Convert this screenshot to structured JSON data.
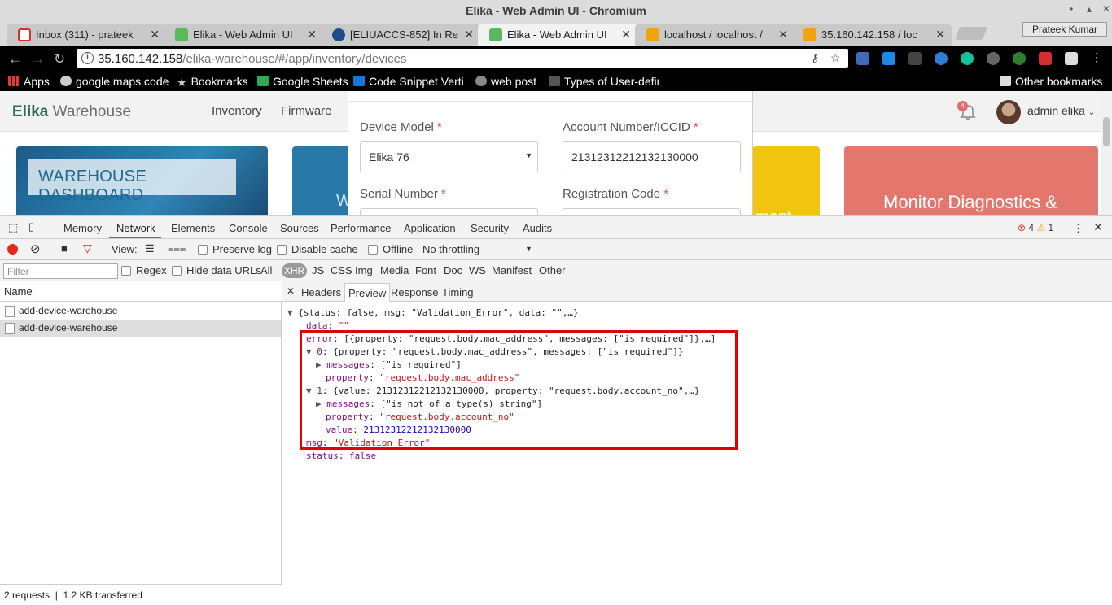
{
  "window": {
    "title": "Elika - Web Admin UI - Chromium",
    "profile": "Prateek Kumar"
  },
  "tabs": [
    {
      "label": "Inbox (311) - prateek"
    },
    {
      "label": "Elika - Web Admin UI"
    },
    {
      "label": "[ELIUACCS-852] In Re"
    },
    {
      "label": "Elika - Web Admin UI"
    },
    {
      "label": "localhost / localhost /"
    },
    {
      "label": "35.160.142.158 / loc"
    }
  ],
  "address": {
    "host": "35.160.142.158",
    "path": "/elika-warehouse/#/app/inventory/devices"
  },
  "bookmarks": {
    "items": [
      "Apps",
      "google maps code",
      "Bookmarks",
      "Google Sheets",
      "Code Snippet Verti",
      "web post",
      "Types of User-define"
    ],
    "other": "Other bookmarks"
  },
  "app": {
    "brand_strong": "Elika",
    "brand_rest": " Warehouse",
    "nav": [
      "Inventory",
      "Firmware"
    ],
    "notifications": "4",
    "user": "admin elika",
    "cards": {
      "dashboard": "WAREHOUSE DASHBOARD",
      "card2": "W",
      "card3": "ment",
      "card4": "Monitor Diagnostics &"
    }
  },
  "form": {
    "device_model_label": "Device Model",
    "device_model_value": "Elika 76",
    "account_label": "Account Number/ICCID",
    "account_value": "21312312212132130000",
    "serial_label": "Serial Number",
    "registration_label": "Registration Code",
    "required": "*"
  },
  "devtools": {
    "tabs": [
      "Memory",
      "Network",
      "Elements",
      "Console",
      "Sources",
      "Performance",
      "Application",
      "Security",
      "Audits"
    ],
    "errors": "4",
    "warnings": "1",
    "toolbar": {
      "view": "View:",
      "preserve_log": "Preserve log",
      "disable_cache": "Disable cache",
      "offline": "Offline",
      "throttling": "No throttling"
    },
    "filter": {
      "placeholder": "Filter",
      "regex": "Regex",
      "hide_data": "Hide data URLs",
      "types": [
        "All",
        "XHR",
        "JS",
        "CSS",
        "Img",
        "Media",
        "Font",
        "Doc",
        "WS",
        "Manifest",
        "Other"
      ]
    },
    "requests": {
      "header": "Name",
      "rows": [
        "add-device-warehouse",
        "add-device-warehouse"
      ],
      "status": "2 requests",
      "transferred": "1.2 KB transferred"
    },
    "detail_tabs": [
      "Headers",
      "Preview",
      "Response",
      "Timing"
    ],
    "preview": {
      "line1": "{status: false, msg: \"Validation_Error\", data: \"\",…}",
      "data_key": "data",
      "data_val": "\"\"",
      "error_key": "error",
      "error_summary": "[{property: \"request.body.mac_address\", messages: [\"is required\"]},…]",
      "e0_key": "0",
      "e0_summary": "{property: \"request.body.mac_address\", messages: [\"is required\"]}",
      "e0_messages": "[\"is required\"]",
      "e0_property": "\"request.body.mac_address\"",
      "e1_key": "1",
      "e1_summary": "{value: 21312312212132130000, property: \"request.body.account_no\",…}",
      "e1_messages": "[\"is not of a type(s) string\"]",
      "e1_property": "\"request.body.account_no\"",
      "e1_value": "21312312212132130000",
      "msg_key": "msg",
      "msg_val": "\"Validation_Error\"",
      "status_key": "status",
      "status_val": "false",
      "messages_key": "messages",
      "property_key": "property",
      "value_key": "value"
    }
  },
  "colors": {
    "brand": "#2b6d57",
    "highlight": "#e00000",
    "tab_active_underline": "#3879d9",
    "record": "#e8271c"
  }
}
